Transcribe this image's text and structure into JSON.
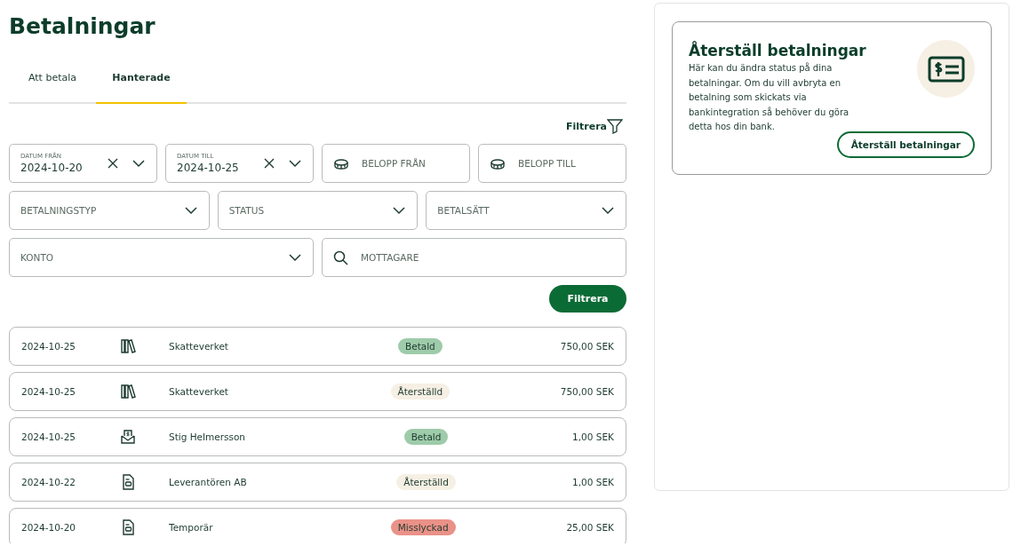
{
  "page": {
    "title": "Betalningar"
  },
  "tabs": [
    {
      "label": "Att betala",
      "selected": false
    },
    {
      "label": "Hanterade",
      "selected": true
    }
  ],
  "filter_toggle": {
    "label": "Filtrera"
  },
  "filter_rows": [
    [
      {
        "kind": "date",
        "label": "DATUM FRÅN",
        "value": "2024-10-20"
      },
      {
        "kind": "date",
        "label": "DATUM TILL",
        "value": "2024-10-25"
      },
      {
        "kind": "amount",
        "placeholder": "BELOPP FRÅN"
      },
      {
        "kind": "amount",
        "placeholder": "BELOPP TILL"
      }
    ],
    [
      {
        "kind": "select",
        "placeholder": "BETALNINGSTYP"
      },
      {
        "kind": "select",
        "placeholder": "STATUS"
      },
      {
        "kind": "select",
        "placeholder": "BETALSÄTT"
      }
    ],
    [
      {
        "kind": "select",
        "placeholder": "KONTO"
      },
      {
        "kind": "search",
        "placeholder": "MOTTAGARE"
      }
    ]
  ],
  "filter_button": {
    "label": "Filtrera"
  },
  "payments": [
    {
      "date": "2024-10-25",
      "kind": "tax",
      "recipient": "Skatteverket",
      "status": {
        "label": "Betald",
        "color": "#9ecbaa"
      },
      "amount": "750,00 SEK"
    },
    {
      "date": "2024-10-25",
      "kind": "tax",
      "recipient": "Skatteverket",
      "status": {
        "label": "Återställd",
        "color": "#f6efe4"
      },
      "amount": "750,00 SEK"
    },
    {
      "date": "2024-10-25",
      "kind": "transfer",
      "recipient": "Stig Helmersson",
      "status": {
        "label": "Betald",
        "color": "#9ecbaa"
      },
      "amount": "1,00 SEK"
    },
    {
      "date": "2024-10-22",
      "kind": "invoice",
      "recipient": "Leverantören AB",
      "status": {
        "label": "Återställd",
        "color": "#f6efe4"
      },
      "amount": "1,00 SEK"
    },
    {
      "date": "2024-10-20",
      "kind": "invoice",
      "recipient": "Temporär",
      "status": {
        "label": "Misslyckad",
        "color": "#ea9188"
      },
      "amount": "25,00 SEK"
    }
  ],
  "side_card": {
    "title": "Återställ betalningar",
    "text": "Här kan du ändra status på dina betalningar. Om du vill avbryta en betalning som skickats via bankintegration så behöver du göra detta hos din bank.",
    "button": "Återställ betalningar"
  }
}
